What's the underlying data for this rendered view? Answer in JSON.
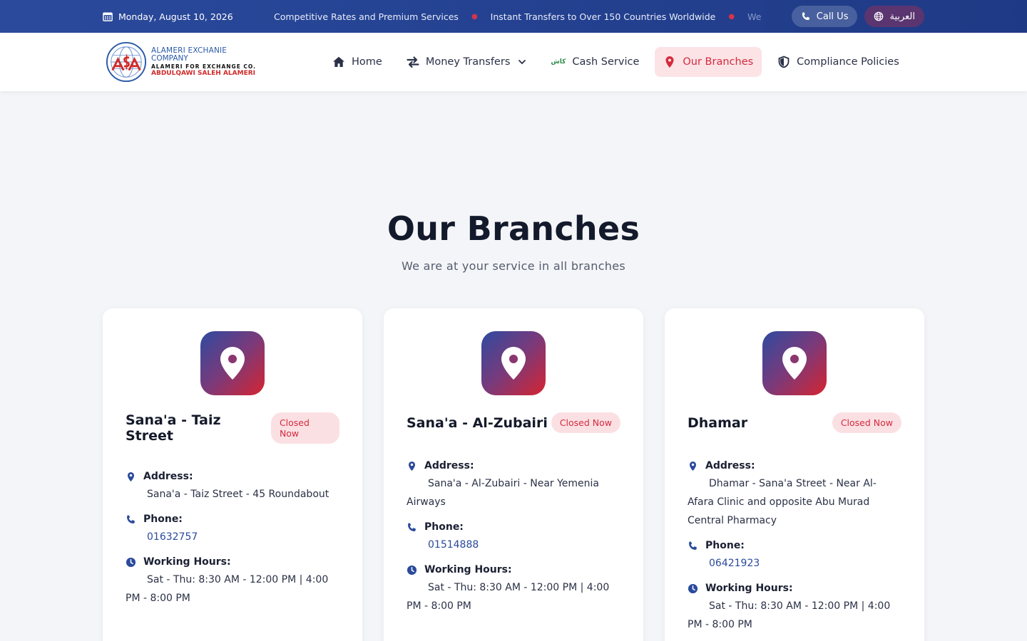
{
  "topbar": {
    "date": "Monday, August 10, 2026",
    "ticker": [
      "Competitive Rates and Premium Services",
      "Instant Transfers to Over 150 Countries Worldwide",
      "We"
    ],
    "call_label": "Call Us",
    "lang_label": "العربية"
  },
  "logo": {
    "line1": "ALAMERI EXCHANIE",
    "line2": "COMPANY",
    "line3": "ALAMERI FOR EXCHANGE CO.",
    "line4": "ABDULQAWI SALEH ALAMERI"
  },
  "nav": {
    "home": "Home",
    "transfers": "Money Transfers",
    "cash": "Cash Service",
    "cash_icon_text": "كاش",
    "branches": "Our Branches",
    "compliance": "Compliance Policies"
  },
  "hero": {
    "title": "Our Branches",
    "subtitle": "We are at your service in all branches"
  },
  "labels": {
    "address": "Address:",
    "phone": "Phone:",
    "hours": "Working Hours:"
  },
  "branches": [
    {
      "name": "Sana'a - Taiz Street",
      "status": "Closed Now",
      "address": "Sana'a - Taiz Street - 45 Roundabout",
      "phone": "01632757",
      "hours": "Sat - Thu: 8:30 AM - 12:00 PM | 4:00 PM - 8:00 PM"
    },
    {
      "name": "Sana'a - Al-Zubairi",
      "status": "Closed Now",
      "address": "Sana'a - Al-Zubairi - Near Yemenia Airways",
      "phone": "01514888",
      "hours": "Sat - Thu: 8:30 AM - 12:00 PM | 4:00 PM - 8:00 PM"
    },
    {
      "name": "Dhamar",
      "status": "Closed Now",
      "address": "Dhamar - Sana'a Street - Near Al-Afara Clinic and opposite Abu Murad Central Pharmacy",
      "phone": "06421923",
      "hours": "Sat - Thu: 8:30 AM - 12:00 PM | 4:00 PM - 8:00 PM"
    }
  ],
  "colors": {
    "primary": "#2b4a9c",
    "accent": "#d52a3e"
  }
}
